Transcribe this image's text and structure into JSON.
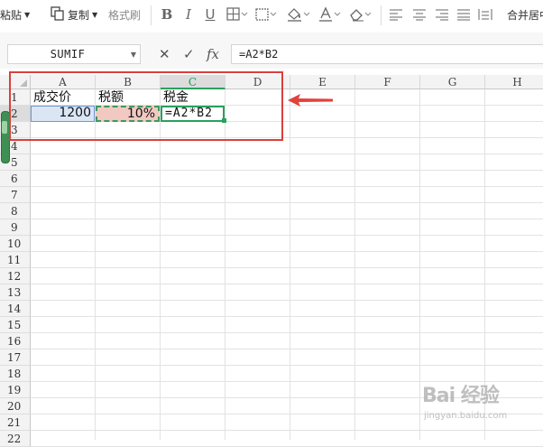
{
  "toolbar": {
    "paste_label": "粘贴",
    "copy_label": "复制",
    "format_painter_label": "格式刷",
    "bold": "B",
    "italic": "I",
    "underline": "U",
    "merge_label": "合并居中"
  },
  "formula_bar": {
    "name_box": "SUMIF",
    "formula": "=A2*B2",
    "fx_label": "fx"
  },
  "columns": [
    "A",
    "B",
    "C",
    "D",
    "E",
    "F",
    "G",
    "H"
  ],
  "active_column": "C",
  "rows": [
    "1",
    "2",
    "3",
    "4",
    "5",
    "6",
    "7",
    "8",
    "9",
    "10",
    "11",
    "12",
    "13",
    "14",
    "15",
    "16",
    "17",
    "18",
    "19",
    "20",
    "21",
    "22"
  ],
  "active_row": "2",
  "cells": {
    "A1": "成交价",
    "B1": "税额",
    "C1": "税金",
    "A2": "1200",
    "B2": "10%",
    "C2": "=A2*B2"
  },
  "colors": {
    "active_accent": "#2aa15c",
    "annotation_red": "#d9403b",
    "a2_fill": "#dbe6f5",
    "b2_fill": "#f2c9c2"
  },
  "watermark": {
    "main": "Bai 经验",
    "sub": "jingyan.baidu.com"
  }
}
